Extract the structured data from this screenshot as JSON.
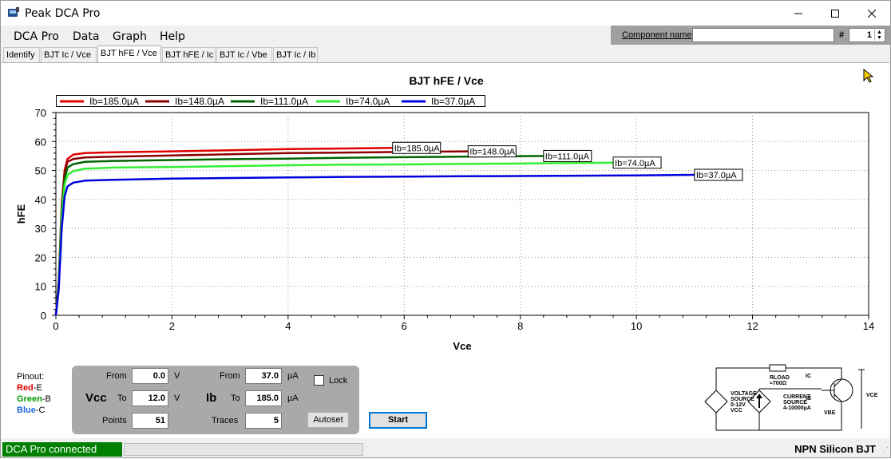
{
  "window": {
    "title": "Peak DCA Pro"
  },
  "menu": [
    "DCA Pro",
    "Data",
    "Graph",
    "Help"
  ],
  "component": {
    "label": "Component name",
    "value": "",
    "hash_label": "#",
    "number": "1"
  },
  "tabs": [
    "Identify",
    "BJT Ic / Vce",
    "BJT hFE / Vce",
    "BJT hFE / Ic",
    "BJT Ic / Vbe",
    "BJT Ic / Ib"
  ],
  "active_tab": "BJT hFE / Vce",
  "chart_data": {
    "type": "line",
    "title": "BJT hFE / Vce",
    "xlabel": "Vce",
    "ylabel": "hFE",
    "xlim": [
      0,
      14
    ],
    "ylim": [
      0,
      70
    ],
    "xticks": [
      "0",
      "2",
      "4",
      "6",
      "8",
      "10",
      "12",
      "14"
    ],
    "yticks": [
      "0",
      "10",
      "20",
      "30",
      "40",
      "50",
      "60",
      "70"
    ],
    "grid": true,
    "legend_position": "top-left",
    "series": [
      {
        "name": "Ib=185.0µA",
        "color": "#e00000",
        "end_label": "Ib=185.0µA",
        "x": [
          0,
          0.05,
          0.1,
          0.15,
          0.2,
          0.3,
          0.5,
          1,
          2,
          3,
          4,
          5,
          5.8
        ],
        "y": [
          0,
          12,
          38,
          50,
          54,
          55.5,
          56,
          56.3,
          56.6,
          57,
          57.4,
          57.6,
          57.8
        ]
      },
      {
        "name": "Ib=148.0µA",
        "color": "#8b0000",
        "end_label": "Ib=148.0µA",
        "x": [
          0,
          0.05,
          0.1,
          0.15,
          0.2,
          0.3,
          0.5,
          1,
          2,
          3,
          4,
          5,
          6,
          7.1
        ],
        "y": [
          0,
          12,
          37,
          49,
          53,
          54,
          54.5,
          54.8,
          55.2,
          55.6,
          56,
          56.2,
          56.4,
          56.6
        ]
      },
      {
        "name": "Ib=111.0µA",
        "color": "#006400",
        "end_label": "Ib=111.0µA",
        "x": [
          0,
          0.05,
          0.1,
          0.15,
          0.2,
          0.3,
          0.5,
          1,
          2,
          3,
          4,
          5,
          6,
          7,
          8.4
        ],
        "y": [
          0,
          11,
          36,
          47,
          51,
          52.2,
          53,
          53.3,
          53.6,
          53.9,
          54.1,
          54.4,
          54.6,
          54.8,
          55
        ]
      },
      {
        "name": "Ib=74.0µA",
        "color": "#33ee33",
        "end_label": "Ib=74.0µA",
        "x": [
          0,
          0.05,
          0.1,
          0.15,
          0.2,
          0.3,
          0.5,
          1,
          2,
          3,
          4,
          5,
          6,
          7,
          8,
          9,
          9.6
        ],
        "y": [
          0,
          10,
          34,
          45,
          48.5,
          49.8,
          50.6,
          51,
          51.2,
          51.5,
          51.8,
          52,
          52.1,
          52.3,
          52.4,
          52.6,
          52.7
        ]
      },
      {
        "name": "Ib=37.0µA",
        "color": "#0000dd",
        "end_label": "Ib=37.0µA",
        "x": [
          0,
          0.05,
          0.1,
          0.15,
          0.2,
          0.3,
          0.5,
          1,
          2,
          3,
          4,
          5,
          6,
          7,
          8,
          9,
          10,
          11
        ],
        "y": [
          0,
          9,
          30,
          41,
          44.5,
          45.8,
          46.5,
          46.8,
          47.2,
          47.4,
          47.6,
          47.8,
          47.9,
          48,
          48.1,
          48.2,
          48.3,
          48.5
        ]
      }
    ]
  },
  "pinout": {
    "title": "Pinout:",
    "items": [
      {
        "color_name": "Red",
        "pin": "-E",
        "color": "#e00000"
      },
      {
        "color_name": "Green",
        "pin": "-B",
        "color": "#009900"
      },
      {
        "color_name": "Blue",
        "pin": "-C",
        "color": "#2266dd"
      }
    ]
  },
  "controls": {
    "vcc_label": "Vcc",
    "ib_label": "Ib",
    "from_label": "From",
    "to_label": "To",
    "points_label": "Points",
    "traces_label": "Traces",
    "vcc_from": "0.0",
    "vcc_to": "12.0",
    "vcc_unit": "V",
    "points": "51",
    "ib_from": "37.0",
    "ib_to": "185.0",
    "ib_unit": "µA",
    "traces": "5",
    "lock_label": "Lock",
    "autoset_label": "Autoset",
    "start_label": "Start"
  },
  "circuit": {
    "voltage_source": [
      "VOLTAGE",
      "SOURCE",
      "0-12V",
      "VCC"
    ],
    "current_source": [
      "CURRENT",
      "SOURCE",
      "4-10000µA"
    ],
    "rload": "RLOAD",
    "rload_value": "≈700Ω",
    "ic": "IC",
    "ib": "IB",
    "vbe": "VBE",
    "vce": "VCE"
  },
  "status": {
    "connection": "DCA Pro connected",
    "device_type": "NPN Silicon BJT"
  }
}
